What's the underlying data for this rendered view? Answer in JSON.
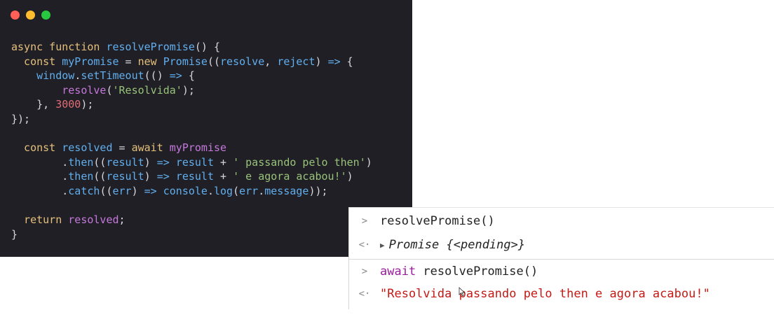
{
  "window_controls": [
    {
      "name": "close",
      "color": "#ff5f57"
    },
    {
      "name": "minimize",
      "color": "#febc2e"
    },
    {
      "name": "zoom",
      "color": "#28c840"
    }
  ],
  "colors": {
    "keyword": "#e5c07b",
    "function": "#61afef",
    "string": "#98c379",
    "number": "#e06c75",
    "variable": "#c678dd",
    "text": "#d6d6dc"
  },
  "code": {
    "lines": [
      [
        {
          "t": "async function ",
          "c": "keyword"
        },
        {
          "t": "resolvePromise",
          "c": "function"
        },
        {
          "t": "() {",
          "c": "text"
        }
      ],
      [
        {
          "t": "  const ",
          "c": "keyword"
        },
        {
          "t": "myPromise",
          "c": "function"
        },
        {
          "t": " = ",
          "c": "text"
        },
        {
          "t": "new ",
          "c": "keyword"
        },
        {
          "t": "Promise",
          "c": "function"
        },
        {
          "t": "((",
          "c": "text"
        },
        {
          "t": "resolve",
          "c": "function"
        },
        {
          "t": ", ",
          "c": "text"
        },
        {
          "t": "reject",
          "c": "function"
        },
        {
          "t": ") ",
          "c": "text"
        },
        {
          "t": "=>",
          "c": "function"
        },
        {
          "t": " {",
          "c": "text"
        }
      ],
      [
        {
          "t": "    window",
          "c": "function"
        },
        {
          "t": ".",
          "c": "text"
        },
        {
          "t": "setTimeout",
          "c": "function"
        },
        {
          "t": "(() ",
          "c": "text"
        },
        {
          "t": "=>",
          "c": "function"
        },
        {
          "t": " {",
          "c": "text"
        }
      ],
      [
        {
          "t": "        resolve",
          "c": "variable"
        },
        {
          "t": "(",
          "c": "text"
        },
        {
          "t": "'Resolvida'",
          "c": "string"
        },
        {
          "t": ");",
          "c": "text"
        }
      ],
      [
        {
          "t": "    }, ",
          "c": "text"
        },
        {
          "t": "3000",
          "c": "number"
        },
        {
          "t": ");",
          "c": "text"
        }
      ],
      [
        {
          "t": "});",
          "c": "text"
        }
      ],
      [],
      [
        {
          "t": "  const ",
          "c": "keyword"
        },
        {
          "t": "resolved",
          "c": "function"
        },
        {
          "t": " = ",
          "c": "text"
        },
        {
          "t": "await ",
          "c": "keyword"
        },
        {
          "t": "myPromise",
          "c": "variable"
        }
      ],
      [
        {
          "t": "        .",
          "c": "text"
        },
        {
          "t": "then",
          "c": "function"
        },
        {
          "t": "((",
          "c": "text"
        },
        {
          "t": "result",
          "c": "function"
        },
        {
          "t": ") ",
          "c": "text"
        },
        {
          "t": "=>",
          "c": "function"
        },
        {
          "t": " ",
          "c": "text"
        },
        {
          "t": "result",
          "c": "function"
        },
        {
          "t": " + ",
          "c": "text"
        },
        {
          "t": "' passando pelo then'",
          "c": "string"
        },
        {
          "t": ")",
          "c": "text"
        }
      ],
      [
        {
          "t": "        .",
          "c": "text"
        },
        {
          "t": "then",
          "c": "function"
        },
        {
          "t": "((",
          "c": "text"
        },
        {
          "t": "result",
          "c": "function"
        },
        {
          "t": ") ",
          "c": "text"
        },
        {
          "t": "=>",
          "c": "function"
        },
        {
          "t": " ",
          "c": "text"
        },
        {
          "t": "result",
          "c": "function"
        },
        {
          "t": " + ",
          "c": "text"
        },
        {
          "t": "' e agora acabou!'",
          "c": "string"
        },
        {
          "t": ")",
          "c": "text"
        }
      ],
      [
        {
          "t": "        .",
          "c": "text"
        },
        {
          "t": "catch",
          "c": "function"
        },
        {
          "t": "((",
          "c": "text"
        },
        {
          "t": "err",
          "c": "function"
        },
        {
          "t": ") ",
          "c": "text"
        },
        {
          "t": "=>",
          "c": "function"
        },
        {
          "t": " ",
          "c": "text"
        },
        {
          "t": "console",
          "c": "function"
        },
        {
          "t": ".",
          "c": "text"
        },
        {
          "t": "log",
          "c": "function"
        },
        {
          "t": "(",
          "c": "text"
        },
        {
          "t": "err",
          "c": "function"
        },
        {
          "t": ".",
          "c": "text"
        },
        {
          "t": "message",
          "c": "function"
        },
        {
          "t": "));",
          "c": "text"
        }
      ],
      [],
      [
        {
          "t": "  return ",
          "c": "keyword"
        },
        {
          "t": "resolved",
          "c": "variable"
        },
        {
          "t": ";",
          "c": "text"
        }
      ],
      [
        {
          "t": "}",
          "c": "text"
        }
      ]
    ]
  },
  "console": {
    "input_prompt_icon": "chevron-right-icon",
    "output_prompt_icon": "return-arrow-icon",
    "input_prompt": ">",
    "output_prompt": "<·",
    "row1": {
      "command": "resolvePromise()"
    },
    "row2": {
      "prefix": "Promise",
      "value": " {<pending>}"
    },
    "row3": {
      "keyword": "await",
      "command": " resolvePromise()"
    },
    "row4": {
      "value": "\"Resolvida passando pelo then e agora acabou!\""
    }
  }
}
